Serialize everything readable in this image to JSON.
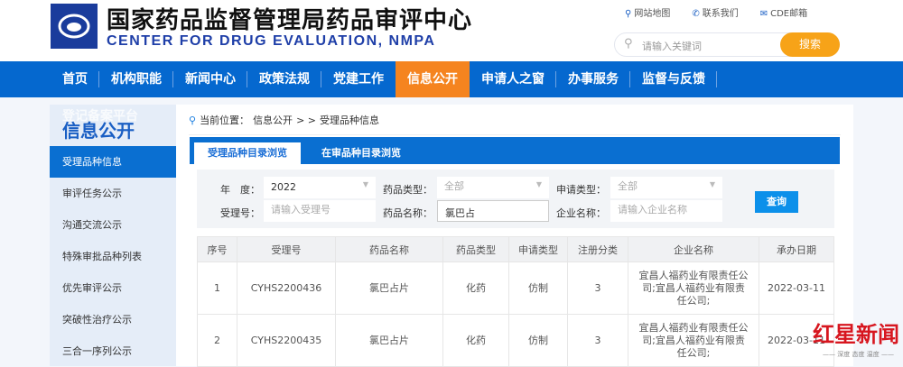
{
  "header": {
    "title_cn": "国家药品监督管理局药品审评中心",
    "title_en": "CENTER FOR DRUG EVALUATION, NMPA",
    "links": [
      "网站地图",
      "联系我们",
      "CDE邮箱"
    ],
    "search_placeholder": "请输入关键词",
    "search_button": "搜索"
  },
  "nav": {
    "items": [
      "首页",
      "机构职能",
      "新闻中心",
      "政策法规",
      "党建工作",
      "信息公开",
      "申请人之窗",
      "办事服务",
      "监督与反馈"
    ],
    "active": "信息公开"
  },
  "sidebar": {
    "ghost": "登记备案平台",
    "title": "信息公开",
    "items": [
      "受理品种信息",
      "审评任务公示",
      "沟通交流公示",
      "特殊审批品种列表",
      "优先审评公示",
      "突破性治疗公示",
      "三合一序列公示"
    ]
  },
  "breadcrumb": {
    "prefix": "当前位置：",
    "path": "信息公开",
    "sep": "> >",
    "current": "受理品种信息"
  },
  "tabs": [
    "受理品种目录浏览",
    "在审品种目录浏览"
  ],
  "filter": {
    "year_label": "年　度：",
    "year_value": "2022",
    "drug_type_label": "药品类型：",
    "drug_type_value": "全部",
    "apply_type_label": "申请类型：",
    "apply_type_value": "全部",
    "accept_no_label": "受理号：",
    "accept_no_placeholder": "请输入受理号",
    "drug_name_label": "药品名称：",
    "drug_name_value": "氯巴占",
    "company_label": "企业名称：",
    "company_placeholder": "请输入企业名称",
    "query_button": "查询"
  },
  "table": {
    "headers": [
      "序号",
      "受理号",
      "药品名称",
      "药品类型",
      "申请类型",
      "注册分类",
      "企业名称",
      "承办日期"
    ],
    "rows": [
      [
        "1",
        "CYHS2200436",
        "氯巴占片",
        "化药",
        "仿制",
        "3",
        "宜昌人福药业有限责任公司;宜昌人福药业有限责任公司;",
        "2022-03-11"
      ],
      [
        "2",
        "CYHS2200435",
        "氯巴占片",
        "化药",
        "仿制",
        "3",
        "宜昌人福药业有限责任公司;宜昌人福药业有限责任公司;",
        "2022-03-11"
      ]
    ]
  },
  "watermark": {
    "brand": "红星新闻",
    "slogan": "—— 深度 态度 温度 ——"
  }
}
